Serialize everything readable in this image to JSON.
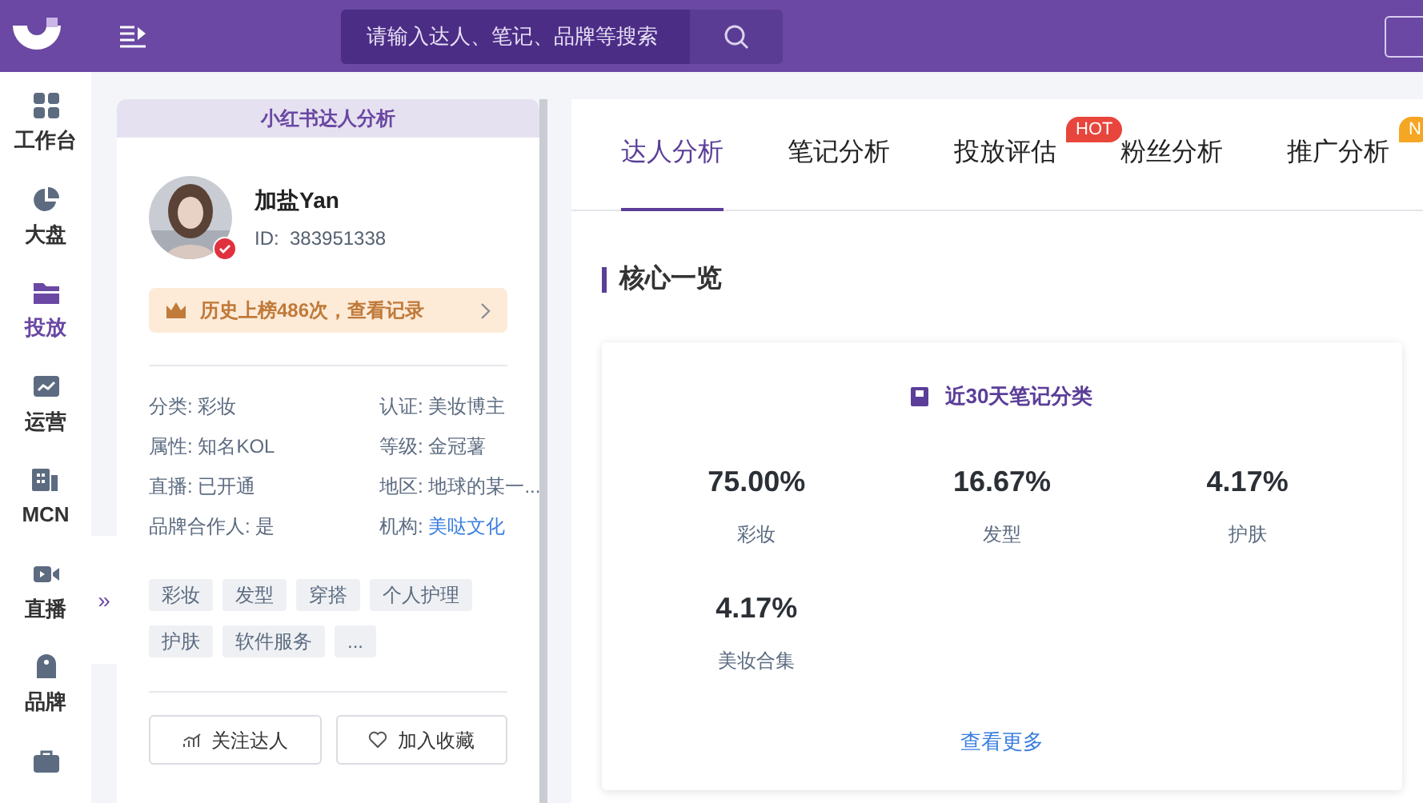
{
  "header": {
    "search": {
      "placeholder": "请输入达人、笔记、品牌等搜索"
    }
  },
  "nav": [
    {
      "label": "工作台",
      "kind": "grid",
      "selected": false
    },
    {
      "label": "大盘",
      "kind": "pie",
      "selected": false
    },
    {
      "label": "投放",
      "kind": "folder",
      "selected": true
    },
    {
      "label": "运营",
      "kind": "chart",
      "selected": false
    },
    {
      "label": "MCN",
      "kind": "building",
      "selected": false
    },
    {
      "label": "直播",
      "kind": "video",
      "selected": false
    },
    {
      "label": "品牌",
      "kind": "tag",
      "selected": false
    }
  ],
  "collapse": {
    "label": "»"
  },
  "profile": {
    "title": "小红书达人分析",
    "name": "加盐Yan",
    "id": "ID:  383951338",
    "verified": true,
    "rank_banner": "历史上榜486次，查看记录",
    "info": [
      {
        "label": "分类:",
        "value": "彩妆",
        "link": false
      },
      {
        "label": "认证:",
        "value": "美妆博主",
        "link": false
      },
      {
        "label": "属性:",
        "value": "知名KOL",
        "link": false
      },
      {
        "label": "等级:",
        "value": "金冠薯",
        "link": false
      },
      {
        "label": "直播:",
        "value": "已开通",
        "link": false
      },
      {
        "label": "地区:",
        "value": "地球的某一...",
        "link": false
      },
      {
        "label": "品牌合作人:",
        "value": "是",
        "link": false
      },
      {
        "label": "机构:",
        "value": "美哒文化",
        "link": true
      }
    ],
    "tags": [
      "彩妆",
      "发型",
      "穿搭",
      "个人护理",
      "护肤",
      "软件服务",
      "..."
    ],
    "actions": [
      {
        "label": "关注达人",
        "kind": "follow"
      },
      {
        "label": "加入收藏",
        "kind": "favorite"
      }
    ]
  },
  "tabs": [
    {
      "label": "达人分析",
      "selected": true
    },
    {
      "label": "笔记分析",
      "selected": false
    },
    {
      "label": "投放评估",
      "selected": false,
      "badge": "HOT",
      "color": "#e8453c"
    },
    {
      "label": "粉丝分析",
      "selected": false
    },
    {
      "label": "推广分析",
      "selected": false,
      "badge": "N",
      "color": "#f5a623"
    }
  ],
  "section": {
    "title": "核心一览"
  },
  "categories_card": {
    "title": "近30天笔记分类",
    "stats": [
      {
        "value": "75.00%",
        "label": "彩妆"
      },
      {
        "value": "16.67%",
        "label": "发型"
      },
      {
        "value": "4.17%",
        "label": "护肤"
      },
      {
        "value": "4.17%",
        "label": "美妆合集"
      }
    ],
    "more": "查看更多"
  }
}
